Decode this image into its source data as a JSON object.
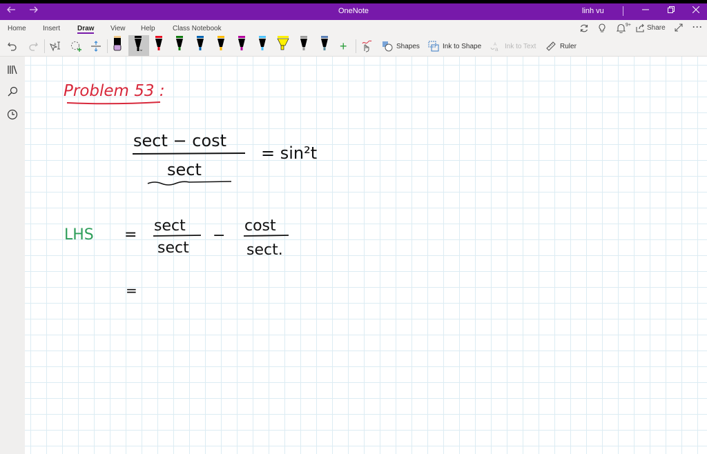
{
  "window": {
    "title": "OneNote",
    "user": "linh vu",
    "back_icon": "arrow-left",
    "forward_icon": "arrow-right",
    "minimize_icon": "minimize",
    "restore_icon": "restore",
    "close_icon": "close"
  },
  "ribbon": {
    "tabs": [
      {
        "label": "Home"
      },
      {
        "label": "Insert"
      },
      {
        "label": "Draw",
        "active": true
      },
      {
        "label": "View"
      },
      {
        "label": "Help"
      },
      {
        "label": "Class Notebook"
      }
    ],
    "right_actions": {
      "sync_icon": "sync",
      "tell_me_icon": "lightbulb",
      "notifications_badge": "9+",
      "share_label": "Share",
      "expand_icon": "expand",
      "more_icon": "ellipsis"
    },
    "draw_tools": {
      "undo": "undo",
      "redo": "redo",
      "lasso": "lasso-select",
      "eraser": "eraser",
      "insert_space": "insert-space",
      "pens": [
        {
          "name": "lavender-pencil",
          "color": "#c9a0dc"
        },
        {
          "name": "black-pen-selected",
          "color": "#000000"
        },
        {
          "name": "red-pen",
          "color": "#e81123"
        },
        {
          "name": "green-pen",
          "color": "#107c10"
        },
        {
          "name": "blue-pen",
          "color": "#0063b1"
        },
        {
          "name": "yellow-orange-pen",
          "color": "#ffb900"
        },
        {
          "name": "magenta-pen",
          "color": "#b4009e"
        },
        {
          "name": "cyan-pen",
          "color": "#4cc2ff"
        },
        {
          "name": "yellow-highlighter",
          "color": "#fff100"
        },
        {
          "name": "galaxy-pen",
          "color": "#9a9a9a"
        },
        {
          "name": "navy-pen",
          "color": "#2d4a78"
        }
      ],
      "add_pen": "+",
      "touch_drawing": "touch-draw",
      "shapes_label": "Shapes",
      "ink_to_shape_label": "Ink to Shape",
      "ink_to_text_label": "Ink to Text",
      "ruler_label": "Ruler"
    }
  },
  "sidebar": {
    "items": [
      {
        "icon": "notebooks"
      },
      {
        "icon": "search"
      },
      {
        "icon": "recent"
      }
    ]
  },
  "page": {
    "heading": "Problem 53 :",
    "heading_color": "#d7283b",
    "equation": {
      "numerator": "sect − cost",
      "denominator": "sect",
      "rhs": "= sin²t"
    },
    "lhs_label": "LHS",
    "lhs_color": "#2e9e5b",
    "step1": {
      "eq": "=",
      "frac1_num": "sect",
      "frac1_den": "sect",
      "minus": "−",
      "frac2_num": "cost",
      "frac2_den": "sect."
    },
    "step2_eq": "="
  }
}
